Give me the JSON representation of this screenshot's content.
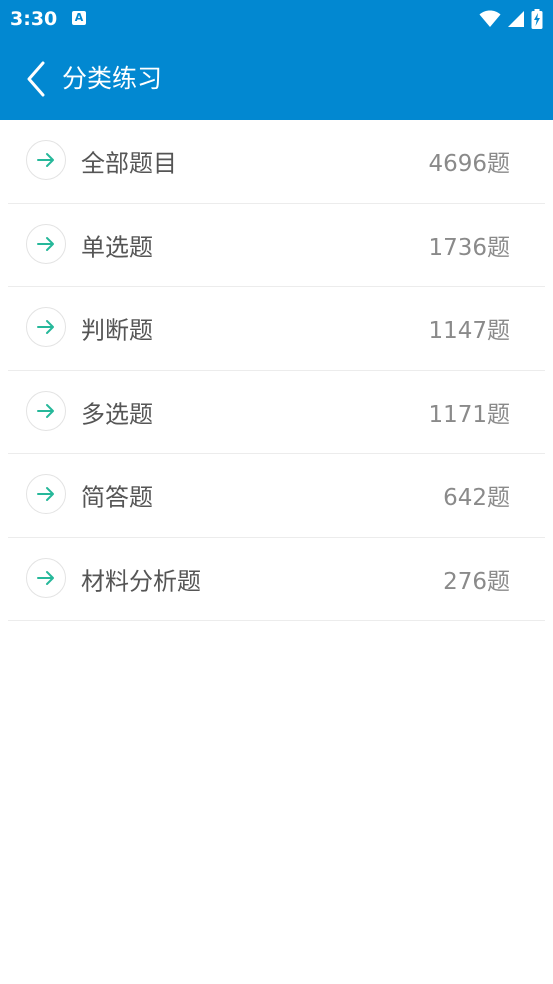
{
  "status_bar": {
    "time": "3:30",
    "notification_icon": "a-icon",
    "wifi_icon": "wifi-icon",
    "signal_icon": "signal-icon",
    "battery_icon": "battery-charging-icon"
  },
  "header": {
    "back_icon": "chevron-left-icon",
    "title": "分类练习"
  },
  "colors": {
    "primary": "#0288d1",
    "accent": "#26b89a",
    "label": "#555555",
    "count": "#8a8a8a"
  },
  "categories": [
    {
      "label": "全部题目",
      "count": "4696题"
    },
    {
      "label": "单选题",
      "count": "1736题"
    },
    {
      "label": "判断题",
      "count": "1147题"
    },
    {
      "label": "多选题",
      "count": "1171题"
    },
    {
      "label": "简答题",
      "count": "642题"
    },
    {
      "label": "材料分析题",
      "count": "276题"
    }
  ]
}
